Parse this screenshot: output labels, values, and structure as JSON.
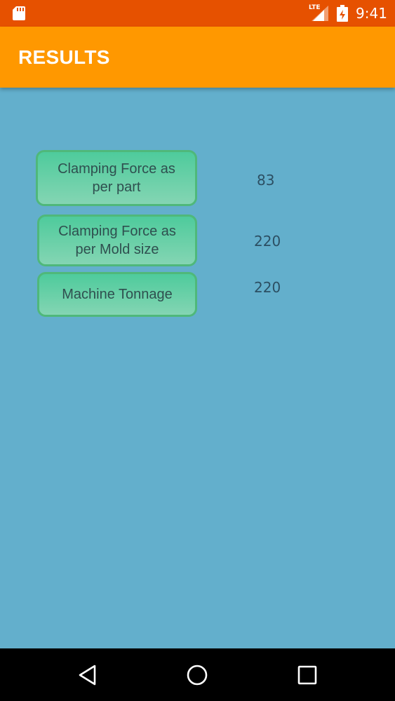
{
  "status_bar": {
    "network": "LTE",
    "time": "9:41",
    "icons": [
      "sd-card-icon",
      "signal-icon",
      "battery-icon"
    ]
  },
  "app_bar": {
    "title": "RESULTS"
  },
  "results": [
    {
      "label": "Clamping Force as per part",
      "value": "83"
    },
    {
      "label": "Clamping Force as per Mold size",
      "value": "220"
    },
    {
      "label": "Machine Tonnage",
      "value": "220"
    }
  ],
  "nav_bar": {
    "icons": [
      "back-icon",
      "home-icon",
      "recents-icon"
    ]
  },
  "colors": {
    "status_bar": "#e65100",
    "app_bar": "#ff9800",
    "background": "#63afcc",
    "button": "#66d0a8"
  }
}
